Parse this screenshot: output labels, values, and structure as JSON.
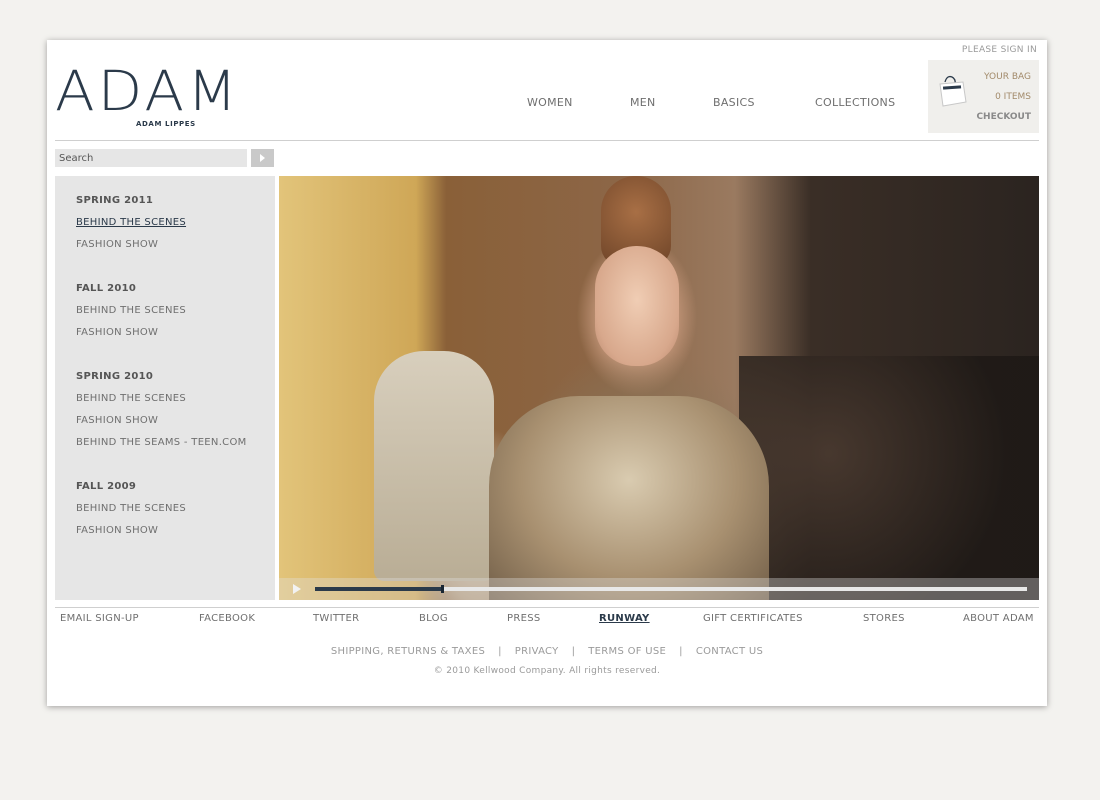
{
  "header": {
    "sign_in": "PLEASE SIGN IN",
    "logo_main": "ADAM",
    "logo_sub": "ADAM LIPPES",
    "nav": [
      "WOMEN",
      "MEN",
      "BASICS",
      "COLLECTIONS"
    ],
    "bag": {
      "your_bag": "YOUR BAG",
      "items": "0 ITEMS",
      "checkout": "CHECKOUT"
    }
  },
  "search": {
    "placeholder": "Search"
  },
  "sidebar": {
    "groups": [
      {
        "title": "SPRING 2011",
        "items": [
          "BEHIND THE SCENES",
          "FASHION SHOW"
        ]
      },
      {
        "title": "FALL 2010",
        "items": [
          "BEHIND THE SCENES",
          "FASHION SHOW"
        ]
      },
      {
        "title": "SPRING 2010",
        "items": [
          "BEHIND THE SCENES",
          "FASHION SHOW",
          "BEHIND THE SEAMS - TEEN.COM"
        ]
      },
      {
        "title": "FALL 2009",
        "items": [
          "BEHIND THE SCENES",
          "FASHION SHOW"
        ]
      }
    ],
    "active": "SPRING 2011 / BEHIND THE SCENES"
  },
  "video": {
    "progress": 0.18
  },
  "footer": {
    "nav": [
      "EMAIL SIGN-UP",
      "FACEBOOK",
      "TWITTER",
      "BLOG",
      "PRESS",
      "RUNWAY",
      "GIFT CERTIFICATES",
      "STORES",
      "ABOUT ADAM"
    ],
    "active": "RUNWAY",
    "legal": [
      "SHIPPING, RETURNS & TAXES",
      "PRIVACY",
      "TERMS OF USE",
      "CONTACT US"
    ],
    "copyright": "© 2010 Kellwood Company. All rights reserved."
  },
  "colors": {
    "brand_navy": "#2b3a4a",
    "bag_text": "#a28a6a",
    "sidebar_bg": "#e6e6e6"
  }
}
